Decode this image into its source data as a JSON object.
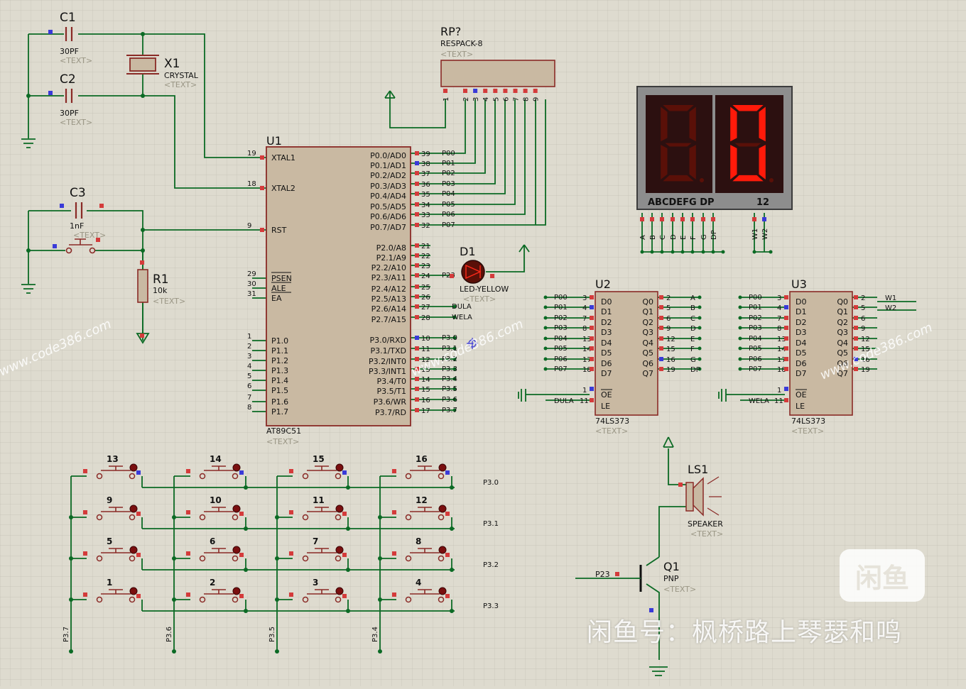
{
  "crystal": {
    "c1_ref": "C1",
    "c1_value": "30PF",
    "c2_ref": "C2",
    "c2_value": "30PF",
    "x1_ref": "X1",
    "x1_value": "CRYSTAL",
    "text_placeholder": "<TEXT>"
  },
  "reset": {
    "c3_ref": "C3",
    "c3_value": "1nF",
    "r1_ref": "R1",
    "r1_value": "10k"
  },
  "respack": {
    "ref": "RP?",
    "value": "RESPACK-8",
    "pins": [
      "1",
      "2",
      "3",
      "4",
      "5",
      "6",
      "7",
      "8",
      "9"
    ]
  },
  "mcu": {
    "ref": "U1",
    "value": "AT89C51",
    "left_pins": [
      {
        "num": "19",
        "name": "XTAL1"
      },
      {
        "num": "18",
        "name": "XTAL2"
      },
      {
        "num": "9",
        "name": "RST"
      },
      {
        "num": "29",
        "name": "PSEN"
      },
      {
        "num": "30",
        "name": "ALE"
      },
      {
        "num": "31",
        "name": "EA"
      },
      {
        "num": "1",
        "name": "P1.0"
      },
      {
        "num": "2",
        "name": "P1.1"
      },
      {
        "num": "3",
        "name": "P1.2"
      },
      {
        "num": "4",
        "name": "P1.3"
      },
      {
        "num": "5",
        "name": "P1.4"
      },
      {
        "num": "6",
        "name": "P1.5"
      },
      {
        "num": "7",
        "name": "P1.6"
      },
      {
        "num": "8",
        "name": "P1.7"
      }
    ],
    "right_pins": [
      {
        "num": "39",
        "name": "P0.0/AD0",
        "net": "P00"
      },
      {
        "num": "38",
        "name": "P0.1/AD1",
        "net": "P01"
      },
      {
        "num": "37",
        "name": "P0.2/AD2",
        "net": "P02"
      },
      {
        "num": "36",
        "name": "P0.3/AD3",
        "net": "P03"
      },
      {
        "num": "35",
        "name": "P0.4/AD4",
        "net": "P04"
      },
      {
        "num": "34",
        "name": "P0.5/AD5",
        "net": "P05"
      },
      {
        "num": "33",
        "name": "P0.6/AD6",
        "net": "P06"
      },
      {
        "num": "32",
        "name": "P0.7/AD7",
        "net": "P07"
      },
      {
        "num": "21",
        "name": "P2.0/A8",
        "net": ""
      },
      {
        "num": "22",
        "name": "P2.1/A9",
        "net": ""
      },
      {
        "num": "23",
        "name": "P2.2/A10",
        "net": ""
      },
      {
        "num": "24",
        "name": "P2.3/A11",
        "net": "P23"
      },
      {
        "num": "25",
        "name": "P2.4/A12",
        "net": ""
      },
      {
        "num": "26",
        "name": "P2.5/A13",
        "net": ""
      },
      {
        "num": "27",
        "name": "P2.6/A14",
        "net": "DULA"
      },
      {
        "num": "28",
        "name": "P2.7/A15",
        "net": "WELA"
      },
      {
        "num": "10",
        "name": "P3.0/RXD",
        "net": "P3.0"
      },
      {
        "num": "11",
        "name": "P3.1/TXD",
        "net": "P3.1"
      },
      {
        "num": "12",
        "name": "P3.2/INT0",
        "net": "P3.2"
      },
      {
        "num": "13",
        "name": "P3.3/INT1",
        "net": "P3.3"
      },
      {
        "num": "14",
        "name": "P3.4/T0",
        "net": "P3.4"
      },
      {
        "num": "15",
        "name": "P3.5/T1",
        "net": "P3.5"
      },
      {
        "num": "16",
        "name": "P3.6/WR",
        "net": "P3.6"
      },
      {
        "num": "17",
        "name": "P3.7/RD",
        "net": "P3.7"
      }
    ]
  },
  "led": {
    "ref": "D1",
    "value": "LED-YELLOW"
  },
  "display": {
    "bottom_label": "ABCDEFG DP",
    "digit_label": "12",
    "seg_pins": [
      "A",
      "B",
      "C",
      "D",
      "E",
      "F",
      "G",
      "DP"
    ],
    "com_pins": [
      "W1",
      "W2"
    ]
  },
  "latch_u2": {
    "ref": "U2",
    "value": "74LS373",
    "d_nets": [
      "P00",
      "P01",
      "P02",
      "P03",
      "P04",
      "P05",
      "P06",
      "P07"
    ],
    "d_pins": [
      "3",
      "4",
      "7",
      "8",
      "13",
      "14",
      "17",
      "18"
    ],
    "d_names": [
      "D0",
      "D1",
      "D2",
      "D3",
      "D4",
      "D5",
      "D6",
      "D7"
    ],
    "q_names": [
      "Q0",
      "Q1",
      "Q2",
      "Q3",
      "Q4",
      "Q5",
      "Q6",
      "Q7"
    ],
    "q_pins": [
      "2",
      "5",
      "6",
      "9",
      "12",
      "15",
      "16",
      "19"
    ],
    "q_nets": [
      "A",
      "B",
      "C",
      "D",
      "E",
      "F",
      "G",
      "DP"
    ],
    "oe": "OE",
    "oe_pin": "1",
    "le": "LE",
    "le_pin": "11",
    "le_net": "DULA"
  },
  "latch_u3": {
    "ref": "U3",
    "value": "74LS373",
    "d_nets": [
      "P00",
      "P01",
      "P02",
      "P03",
      "P04",
      "P05",
      "P06",
      "P07"
    ],
    "d_pins": [
      "3",
      "4",
      "7",
      "8",
      "13",
      "14",
      "17",
      "18"
    ],
    "d_names": [
      "D0",
      "D1",
      "D2",
      "D3",
      "D4",
      "D5",
      "D6",
      "D7"
    ],
    "q_names": [
      "Q0",
      "Q1",
      "Q2",
      "Q3",
      "Q4",
      "Q5",
      "Q6",
      "Q7"
    ],
    "q_pins": [
      "2",
      "5",
      "6",
      "9",
      "12",
      "15",
      "16",
      "19"
    ],
    "q_nets": [
      "W1",
      "W2",
      "",
      "",
      "",
      "",
      "",
      ""
    ],
    "oe": "OE",
    "oe_pin": "1",
    "le": "LE",
    "le_pin": "11",
    "le_net": "WELA"
  },
  "speaker": {
    "ref": "LS1",
    "value": "SPEAKER"
  },
  "transistor": {
    "ref": "Q1",
    "value": "PNP",
    "base_net": "P23"
  },
  "keypad": {
    "rows": [
      [
        "13",
        "14",
        "15",
        "16"
      ],
      [
        "9",
        "10",
        "11",
        "12"
      ],
      [
        "5",
        "6",
        "7",
        "8"
      ],
      [
        "1",
        "2",
        "3",
        "4"
      ]
    ],
    "row_nets": [
      "P3.0",
      "P3.1",
      "P3.2",
      "P3.3"
    ],
    "col_nets": [
      "P3.7",
      "P3.6",
      "P3.5",
      "P3.4"
    ]
  },
  "watermarks": {
    "site": "www.code386.com",
    "footer": "闲鱼号：枫桥路上琴瑟和鸣",
    "logo": "闲鱼"
  },
  "colors": {
    "background": "#dedbcf",
    "wire": "#0b6a24",
    "body": "#c9b9a2",
    "outline": "#8a2a26",
    "text": "#111111",
    "pin_red": "#d43b3b",
    "pin_blue": "#3a3ad8",
    "segment_on": "#ff1a0a",
    "segment_off": "#5a1008"
  }
}
